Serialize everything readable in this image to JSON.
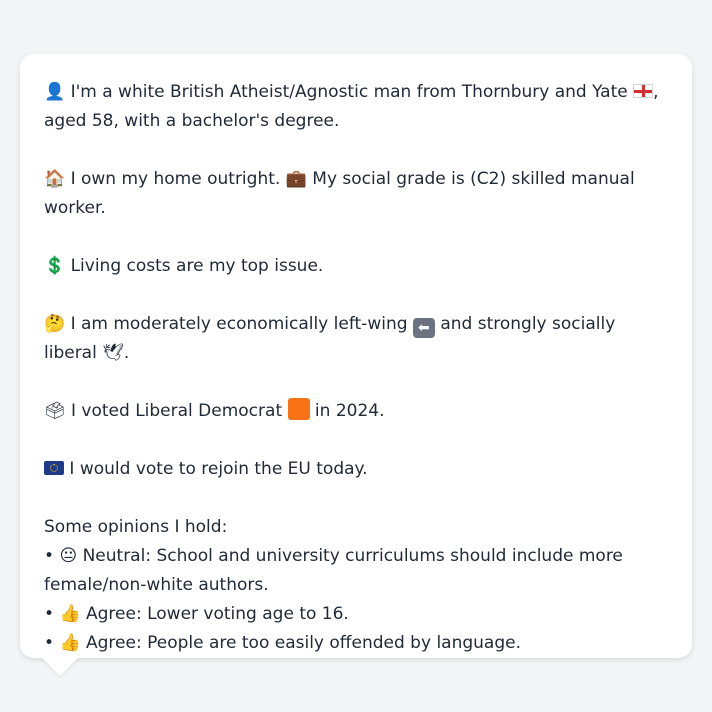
{
  "profile": {
    "intro_icon": "👤",
    "intro_text": "I'm a white British Atheist/Agnostic man from Thornbury and Yate",
    "intro_suffix": ", aged 58, with a bachelor's degree.",
    "home_icon": "🏠",
    "home_text": "I own my home outright.",
    "grade_icon": "💼",
    "grade_text": "My social grade is (C2) skilled manual worker.",
    "cost_icon": "💲",
    "cost_text": "Living costs are my top issue.",
    "politics_icon": "🤔",
    "politics_text_a": "I am moderately economically left-wing",
    "politics_text_b": "and strongly socially liberal",
    "dove_icon": "🕊",
    "politics_end": ".",
    "vote_icon": "🗳",
    "vote_text_a": "I voted Liberal Democrat",
    "vote_text_b": "in 2024.",
    "eu_text": "I would vote to rejoin the EU today.",
    "opinions_heading": "Some opinions I hold:",
    "opinions": [
      {
        "bullet": "•",
        "icon": "😐",
        "text": "Neutral: School and university curriculums should include more female/non-white authors."
      },
      {
        "bullet": "•",
        "icon": "👍",
        "text": "Agree: Lower voting age to 16."
      },
      {
        "bullet": "•",
        "icon": "👍",
        "text": "Agree: People are too easily offended by language."
      }
    ]
  },
  "colors": {
    "background": "#f3f4f6",
    "card": "#ffffff",
    "text": "#1f2937",
    "party_orange": "#f97316"
  }
}
